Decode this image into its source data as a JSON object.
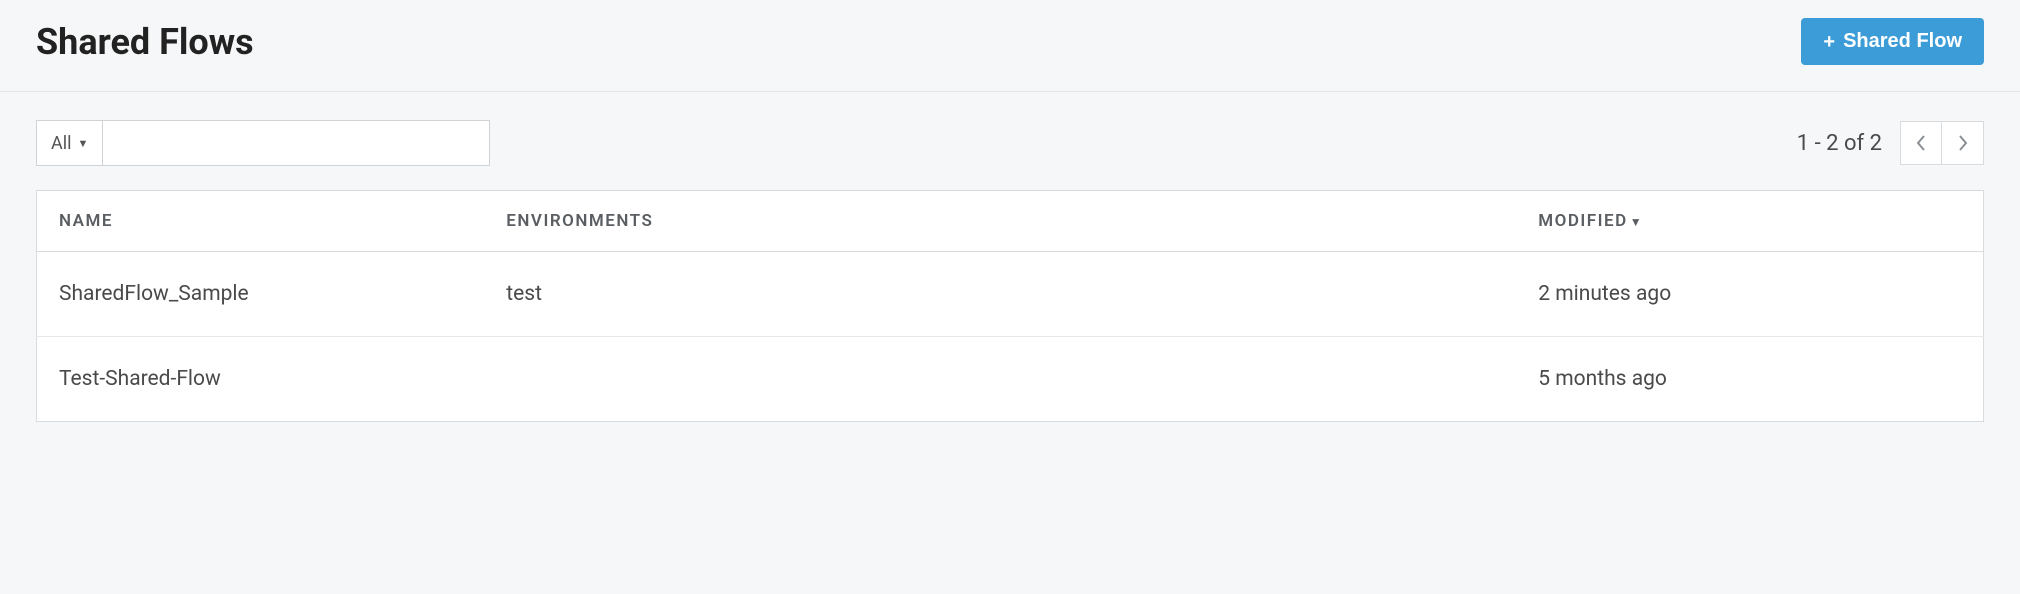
{
  "header": {
    "title": "Shared Flows",
    "create_button_label": "Shared Flow"
  },
  "toolbar": {
    "filter_label": "All",
    "search_value": "",
    "pagination_text": "1 - 2 of 2"
  },
  "table": {
    "columns": {
      "name": "NAME",
      "environments": "ENVIRONMENTS",
      "modified": "MODIFIED"
    },
    "sort": {
      "column": "modified",
      "direction": "desc",
      "indicator": "▼"
    },
    "rows": [
      {
        "name": "SharedFlow_Sample",
        "environments": "test",
        "modified": "2 minutes ago"
      },
      {
        "name": "Test-Shared-Flow",
        "environments": "",
        "modified": "5 months ago"
      }
    ]
  }
}
